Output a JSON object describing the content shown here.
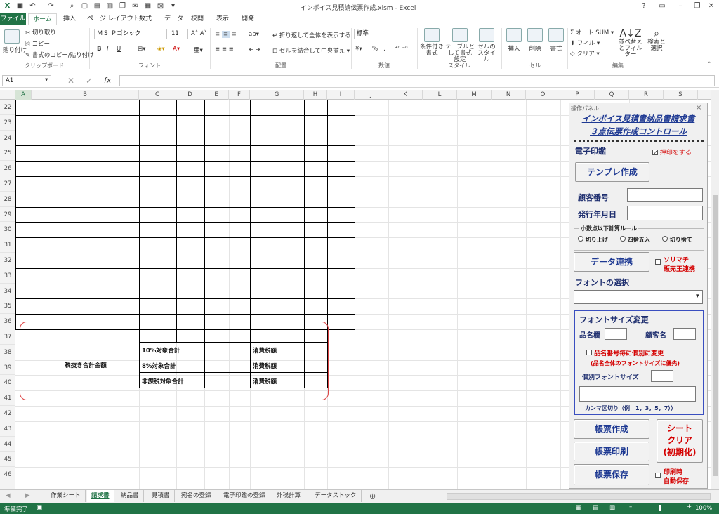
{
  "window": {
    "title": "インボイス見積請伝票作成.xlsm - Excel"
  },
  "menu": [
    "ファイル",
    "ホーム",
    "挿入",
    "ページ レイアウト",
    "数式",
    "データ",
    "校閲",
    "表示",
    "開発"
  ],
  "ribbon": {
    "clipboard": {
      "paste": "貼り付け",
      "cut": "切り取り",
      "copy": "コピー",
      "format_painter": "書式のコピー/貼り付け",
      "group": "クリップボード"
    },
    "font": {
      "name": "ＭＳ Ｐゴシック",
      "size": "11",
      "bold": "B",
      "italic": "I",
      "underline": "U",
      "group": "フォント"
    },
    "alignment": {
      "wrap": "折り返して全体を表示する",
      "merge": "セルを結合して中央揃え",
      "group": "配置"
    },
    "number": {
      "format": "標準",
      "percent": "%",
      "comma": ",",
      "group": "数値"
    },
    "styles": {
      "cond": "条件付き書式",
      "table": "テーブルとして書式設定",
      "cell": "セルのスタイル",
      "group": "スタイル"
    },
    "cells": {
      "insert": "挿入",
      "delete": "削除",
      "format": "書式",
      "group": "セル"
    },
    "editing": {
      "autosum": "オート SUM",
      "fill": "フィル",
      "clear": "クリア",
      "sort": "並べ替えとフィルター",
      "find": "検索と選択",
      "group": "編集"
    }
  },
  "formula_bar": {
    "name_box": "A1",
    "fx": "fx",
    "value": ""
  },
  "columns": [
    "A",
    "B",
    "C",
    "D",
    "E",
    "F",
    "G",
    "H",
    "I",
    "J",
    "K",
    "L",
    "M",
    "N",
    "O",
    "P",
    "Q",
    "R",
    "S"
  ],
  "rows": [
    "22",
    "23",
    "24",
    "25",
    "26",
    "27",
    "28",
    "29",
    "30",
    "31",
    "32",
    "33",
    "34",
    "35",
    "36",
    "37",
    "38",
    "39",
    "40",
    "41",
    "42",
    "43",
    "44",
    "45",
    "46"
  ],
  "sheet_cells": {
    "subtotal_label": "税抜き合計金額",
    "r38_c": "10%対象合計",
    "r39_c": "8%対象合計",
    "r40_c": "非課税対象合計",
    "r38_g": "消費税額",
    "r39_g": "消費税額",
    "r40_g": "消費税額"
  },
  "panel": {
    "caption": "操作パネル",
    "close": "×",
    "title1": "インボイス見積書納品書請求書",
    "title2": "３点伝票作成コントロール",
    "seal_label": "電子印鑑",
    "stamp_check": "押印をする",
    "template_btn": "テンプレ作成",
    "customer_no": "顧客番号",
    "issue_date": "発行年月日",
    "rounding_group": "小数点以下計算ルール",
    "round_up": "切り上げ",
    "round_half": "四捨五入",
    "round_down": "切り捨て",
    "data_link_btn": "データ連携",
    "sorimachi": "ソリマチ",
    "hanbai": "販売王連携",
    "font_select": "フォントの選択",
    "font_size_change": "フォントサイズ変更",
    "item_col": "品名欄",
    "cust_name": "顧客名",
    "per_item": "品名番号毎に個別に変更",
    "priority": "(品名全体のフォントサイズに優先)",
    "indiv_size": "個別フォントサイズ",
    "comma_note": "カンマ区切り（例　1，3，5，7））",
    "create_btn": "帳票作成",
    "print_btn": "帳票印刷",
    "save_btn": "帳票保存",
    "clear_btn1": "シート",
    "clear_btn2": "クリア",
    "clear_btn3": "(初期化)",
    "auto_save1": "印刷時",
    "auto_save2": "自動保存"
  },
  "tabs": [
    "作業シート",
    "請求書",
    "納品書",
    "見積書",
    "宛名の登録",
    "電子印鑑の登録",
    "外税計算",
    "データストック"
  ],
  "status": {
    "ready": "準備完了",
    "zoom": "100%"
  },
  "colors": {
    "excel_green": "#217346",
    "panel_blue": "#1f3a93",
    "red": "#d40000"
  }
}
